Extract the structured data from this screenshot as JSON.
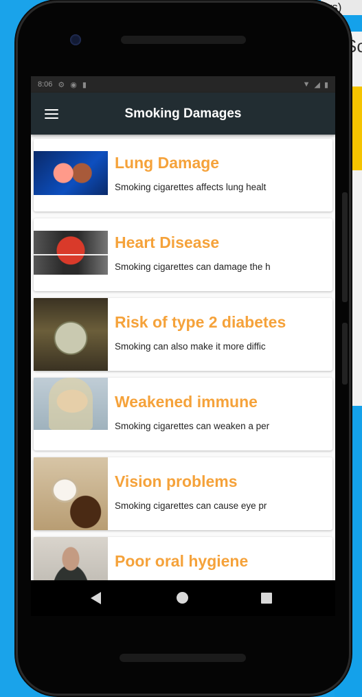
{
  "desktop": {
    "title_fragment": "ws)",
    "panel_fragment": "Sc"
  },
  "status_bar": {
    "time": "8:06"
  },
  "app_bar": {
    "title": "Smoking Damages"
  },
  "items": [
    {
      "title": "Lung Damage",
      "description": "Smoking cigarettes affects lung healt",
      "image": "lung-image"
    },
    {
      "title": "Heart Disease",
      "description": "Smoking cigarettes can damage the h",
      "image": "heart-image"
    },
    {
      "title": "Risk of type 2 diabetes",
      "description": "Smoking can also make it more diffic",
      "image": "diabetes-image"
    },
    {
      "title": "Weakened immune",
      "description": "Smoking cigarettes can weaken a per",
      "image": "immune-image"
    },
    {
      "title": "Vision problems",
      "description": "Smoking cigarettes can cause eye pr",
      "image": "vision-image"
    },
    {
      "title": "Poor oral hygiene",
      "description": "",
      "image": "oral-image"
    }
  ],
  "colors": {
    "accent_title": "#f5a23a",
    "app_bar": "#222d32",
    "desktop_bg": "#1aa3ea"
  }
}
